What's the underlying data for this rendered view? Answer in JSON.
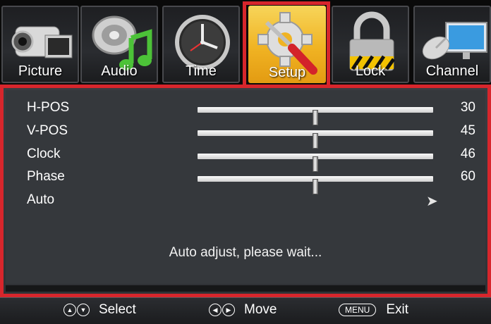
{
  "tabs": [
    {
      "label": "Picture",
      "icon": "camcorder-icon"
    },
    {
      "label": "Audio",
      "icon": "speaker-music-note-icon"
    },
    {
      "label": "Time",
      "icon": "clock-icon"
    },
    {
      "label": "Setup",
      "icon": "gear-wrench-icon",
      "active": true
    },
    {
      "label": "Lock",
      "icon": "padlock-icon"
    },
    {
      "label": "Channel",
      "icon": "satellite-dish-monitor-icon"
    }
  ],
  "settings": [
    {
      "label": "H-POS",
      "value": "30",
      "level": 0.5
    },
    {
      "label": "V-POS",
      "value": "45",
      "level": 0.5
    },
    {
      "label": "Clock",
      "value": "46",
      "level": 0.5
    },
    {
      "label": "Phase",
      "value": "60",
      "level": 0.5
    }
  ],
  "auto": {
    "label": "Auto",
    "arrow": "➤"
  },
  "message": "Auto adjust, please wait...",
  "footer": {
    "select": "Select",
    "move": "Move",
    "menu_key": "MENU",
    "exit": "Exit",
    "up_glyph": "▲",
    "down_glyph": "▼",
    "left_glyph": "◀",
    "right_glyph": "▶"
  },
  "colors": {
    "highlight": "#d7262c",
    "active_tab": "#f0b323",
    "panel": "#35383c"
  }
}
